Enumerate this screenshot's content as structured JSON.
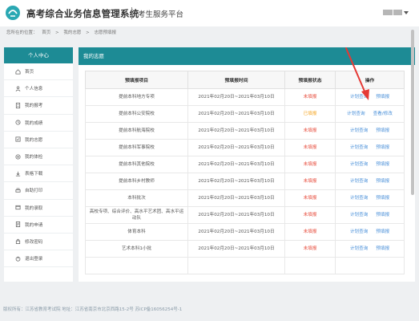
{
  "header": {
    "title": "高考综合业务信息管理系统",
    "subtitle": "考生服务平台"
  },
  "breadcrumb": {
    "label": "您所在的位置：",
    "items": [
      "首页",
      "我的志愿",
      "志愿预填报"
    ]
  },
  "sidebar": {
    "title": "个人中心",
    "items": [
      {
        "label": "首页",
        "icon": "home-icon"
      },
      {
        "label": "个人信息",
        "icon": "person-icon"
      },
      {
        "label": "我的报考",
        "icon": "document-icon"
      },
      {
        "label": "我的成绩",
        "icon": "score-icon"
      },
      {
        "label": "我的志愿",
        "icon": "volunteer-icon"
      },
      {
        "label": "我的体检",
        "icon": "checkup-icon"
      },
      {
        "label": "表格下载",
        "icon": "download-icon"
      },
      {
        "label": "自助打印",
        "icon": "print-icon"
      },
      {
        "label": "我的录取",
        "icon": "admission-icon"
      },
      {
        "label": "我的申请",
        "icon": "application-icon"
      },
      {
        "label": "修改密码",
        "icon": "lock-icon"
      },
      {
        "label": "退出登录",
        "icon": "logout-icon"
      }
    ]
  },
  "panel": {
    "title": "我的志愿"
  },
  "table": {
    "headers": [
      "预填报项目",
      "预填报时间",
      "预填报状态",
      "操作"
    ],
    "rows": [
      {
        "project": "提前本科地方专项",
        "time": "2021年02月20日~2021年03月10日",
        "status": "未填报",
        "status_color": "#e74c3c",
        "action1": "计划查询",
        "action2": "预填报"
      },
      {
        "project": "提前本科公安院校",
        "time": "2021年02月20日~2021年03月10日",
        "status": "已填报",
        "status_color": "#f5a623",
        "action1": "计划查询",
        "action2": "查看/修改"
      },
      {
        "project": "提前本科航海院校",
        "time": "2021年02月20日~2021年03月10日",
        "status": "未填报",
        "status_color": "#e74c3c",
        "action1": "计划查询",
        "action2": "预填报"
      },
      {
        "project": "提前本科军事院校",
        "time": "2021年02月20日~2021年03月10日",
        "status": "未填报",
        "status_color": "#e74c3c",
        "action1": "计划查询",
        "action2": "预填报"
      },
      {
        "project": "提前本科其他院校",
        "time": "2021年02月20日~2021年03月10日",
        "status": "未填报",
        "status_color": "#e74c3c",
        "action1": "计划查询",
        "action2": "预填报"
      },
      {
        "project": "提前本科乡村教师",
        "time": "2021年02月20日~2021年03月10日",
        "status": "未填报",
        "status_color": "#e74c3c",
        "action1": "计划查询",
        "action2": "预填报"
      },
      {
        "project": "本科批次",
        "time": "2021年02月20日~2021年03月10日",
        "status": "未填报",
        "status_color": "#e74c3c",
        "action1": "计划查询",
        "action2": "预填报"
      },
      {
        "project": "高校专项、综合评价、高水平艺术团、高水平运动队",
        "time": "2021年02月20日~2021年03月10日",
        "status": "未填报",
        "status_color": "#e74c3c",
        "action1": "计划查询",
        "action2": "预填报"
      },
      {
        "project": "体育本科",
        "time": "2021年02月20日~2021年03月10日",
        "status": "未填报",
        "status_color": "#e74c3c",
        "action1": "计划查询",
        "action2": "预填报"
      },
      {
        "project": "艺术本科1小批",
        "time": "2021年02月20日~2021年03月10日",
        "status": "未填报",
        "status_color": "#e74c3c",
        "action1": "计划查询",
        "action2": "预填报"
      },
      {
        "project": "",
        "time": "",
        "status": "",
        "status_color": "#e74c3c",
        "action1": "",
        "action2": ""
      }
    ]
  },
  "footer": {
    "text": "版权所有：江苏省教育考试院 地址：江苏省南京市北京西路15-2号 苏ICP备16056254号-1"
  }
}
